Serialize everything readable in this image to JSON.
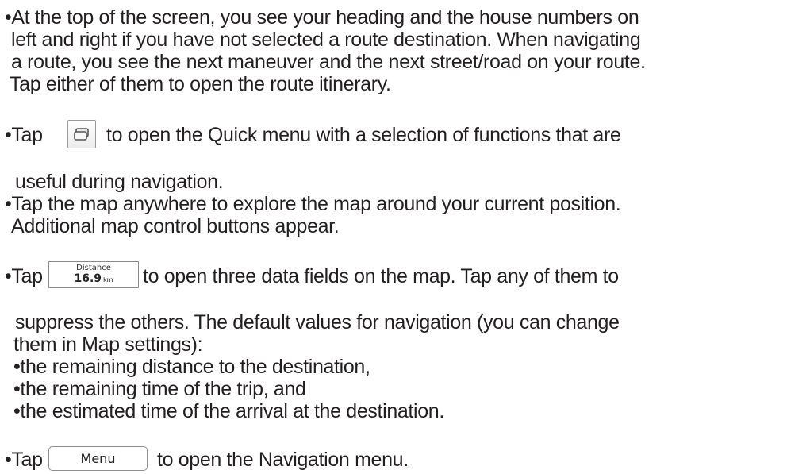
{
  "paragraph1": {
    "lines": [
      "•At the top of the screen, you see your heading and the house numbers on",
      "left and right if you have not selected a route destination. When navigating",
      "a route, you see the next maneuver and the next street/road on your route.",
      "Tap either of them to open the route itinerary."
    ]
  },
  "paragraph2": {
    "prefix": "•Tap",
    "icon": "quick-menu-icon",
    "suffix": "to open the Quick menu with a selection of functions that are",
    "continuation": "useful during navigation."
  },
  "paragraph3": {
    "lines": [
      "•Tap the map anywhere to explore the map around your current position.",
      "Additional map control buttons appear."
    ]
  },
  "paragraph4": {
    "prefix": "•Tap",
    "distance_button": {
      "label": "Distance",
      "value": "16.9",
      "unit": "km"
    },
    "suffix": "to open three data fields on the map. Tap any of them to",
    "continuation": [
      "suppress the others. The default values for navigation (you can change",
      "them in Map settings):",
      "•the remaining distance to the destination,",
      "•the remaining time of the trip, and",
      "•the estimated time of the arrival at the destination."
    ]
  },
  "paragraph5": {
    "prefix": "•Tap",
    "menu_button_label": "Menu",
    "suffix": "to open the Navigation menu."
  }
}
